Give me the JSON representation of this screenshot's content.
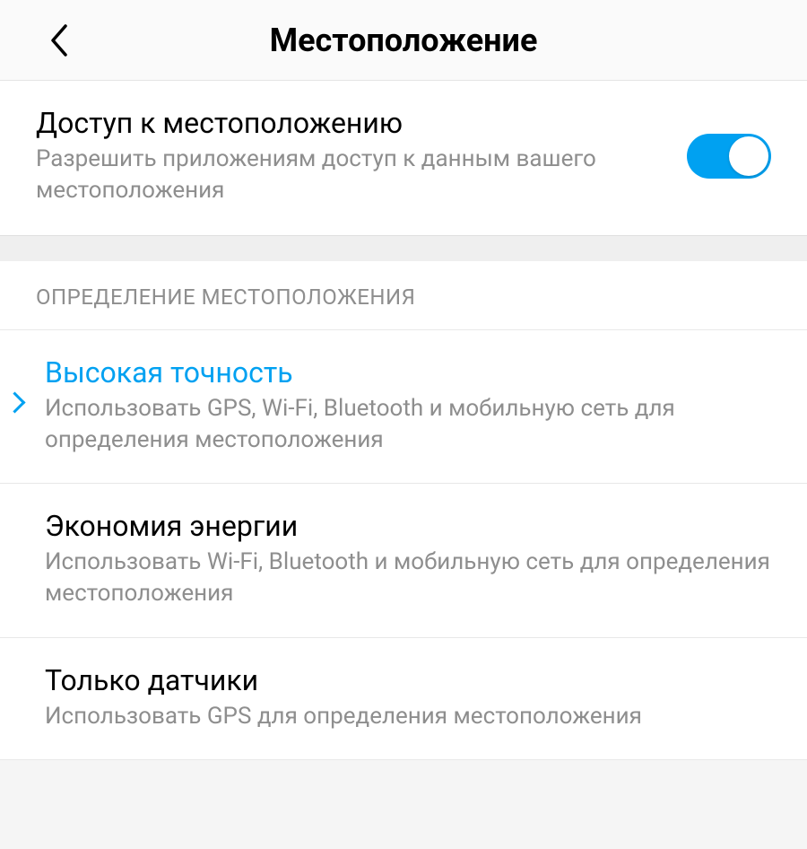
{
  "header": {
    "title": "Местоположение"
  },
  "locationAccess": {
    "title": "Доступ к местоположению",
    "desc": "Разрешить приложениям доступ к данным вашего местоположения",
    "enabled": true
  },
  "groupHeader": "ОПРЕДЕЛЕНИЕ МЕСТОПОЛОЖЕНИЯ",
  "options": [
    {
      "title": "Высокая точность",
      "desc": "Использовать GPS, Wi-Fi, Bluetooth и мобильную сеть для определения местоположения",
      "selected": true
    },
    {
      "title": "Экономия энергии",
      "desc": "Использовать Wi-Fi, Bluetooth и мобильную сеть для определения местоположения",
      "selected": false
    },
    {
      "title": "Только датчики",
      "desc": "Использовать GPS для определения местоположения",
      "selected": false
    }
  ]
}
